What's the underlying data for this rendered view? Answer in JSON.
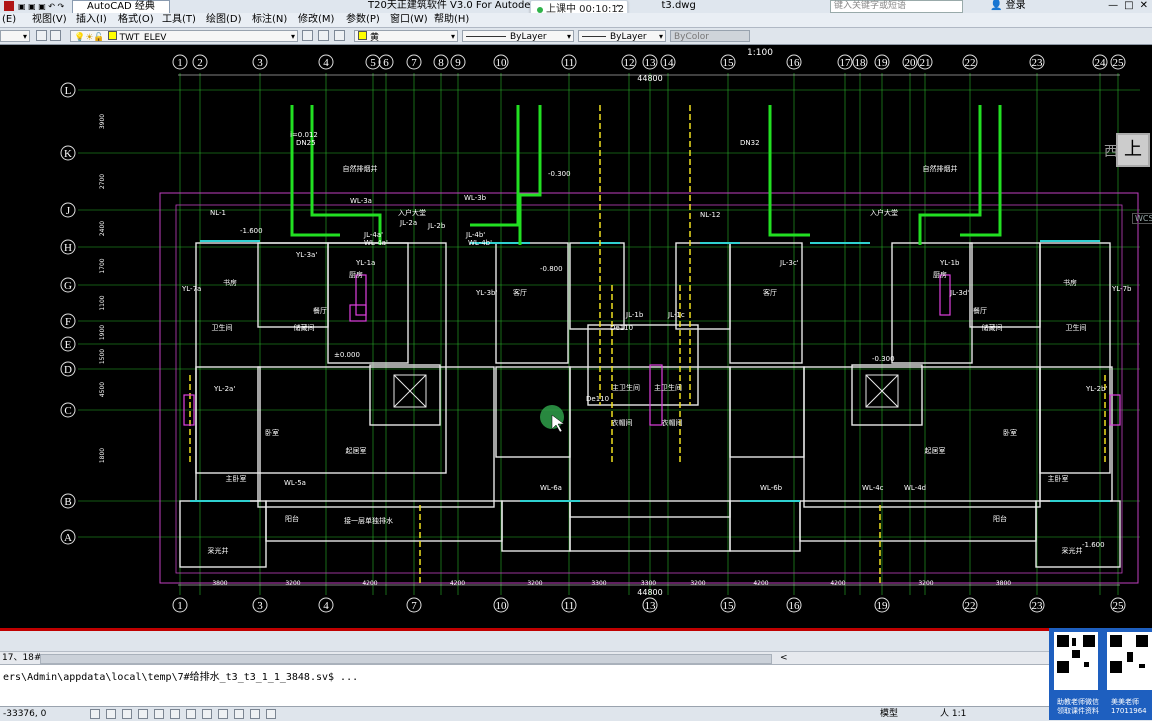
{
  "window": {
    "workspace": "AutoCAD 经典",
    "title": "T20天正建筑软件 V3.0 For Autodesk A",
    "title_tail": "t3.dwg",
    "search_placeholder": "键入关键字或短语",
    "login": "登录",
    "controls": [
      "—",
      "□",
      "✕"
    ]
  },
  "meeting": {
    "status": "上课中 00:10:12"
  },
  "menu": [
    "(E)",
    "视图(V)",
    "插入(I)",
    "格式(O)",
    "工具(T)",
    "绘图(D)",
    "标注(N)",
    "修改(M)",
    "参数(P)",
    "窗口(W)",
    "帮助(H)"
  ],
  "toolbar": {
    "layer": "TWT_ELEV",
    "color": "黄",
    "linetype": "ByLayer",
    "lineweight": "ByLayer",
    "plotstyle": "ByColor"
  },
  "drawing": {
    "axis_numbers": [
      "1",
      "2",
      "3",
      "4",
      "5",
      "6",
      "7",
      "8",
      "9",
      "10",
      "11",
      "12",
      "13",
      "14",
      "15",
      "16",
      "17",
      "18",
      "19",
      "20",
      "21",
      "22",
      "23",
      "24",
      "25"
    ],
    "axis_numbers_bottom": [
      "1",
      "3",
      "4",
      "7",
      "10",
      "11",
      "13",
      "15",
      "16",
      "19",
      "22",
      "23",
      "25"
    ],
    "axis_letters": [
      "L",
      "K",
      "J",
      "H",
      "G",
      "F",
      "E",
      "D",
      "C",
      "B",
      "A"
    ],
    "overall_dim": "44800",
    "scale_label": "1:100",
    "bottom_dims": [
      "3800",
      "3200",
      "4200",
      "4200",
      "3200",
      "3300",
      "3300",
      "3200",
      "4200",
      "4200",
      "3200",
      "3800"
    ],
    "left_dims": [
      "3900",
      "2700",
      "2400",
      "1700",
      "1100",
      "1900",
      "1500",
      "4500",
      "1800"
    ],
    "rooms": [
      {
        "label": "书房"
      },
      {
        "label": "卧室"
      },
      {
        "label": "起居室"
      },
      {
        "label": "主卧室"
      },
      {
        "label": "厨房"
      },
      {
        "label": "餐厅"
      },
      {
        "label": "阳台"
      },
      {
        "label": "储藏间"
      },
      {
        "label": "卫生间"
      },
      {
        "label": "入户大堂"
      },
      {
        "label": "主卫生间"
      },
      {
        "label": "客厅"
      },
      {
        "label": "采光井"
      },
      {
        "label": "衣帽间"
      },
      {
        "label": "自然排烟井"
      }
    ],
    "pipe_labels": [
      "WL-3a",
      "WL-3b",
      "JL-2a",
      "JL-2b",
      "JL-4a'",
      "JL-4b'",
      "YL-3a'",
      "YL-3b'",
      "WL-4a'",
      "WL-4b'",
      "YL-7a",
      "YL-7b",
      "YL-2a'",
      "YL-2b'",
      "WL-5a",
      "WL-6a",
      "WL-6b",
      "WL-4c",
      "WL-4d",
      "YL-1a",
      "YL-1b",
      "NL-1",
      "NL-12",
      "JL-1b",
      "JL-1c",
      "JL-3c'",
      "JL-3d'"
    ],
    "levels": [
      "-1.600",
      "-0.800",
      "-0.300",
      "±0.000",
      "-0.300",
      "-1.600"
    ],
    "notes": [
      "接一层单独排水",
      "De110",
      "De110",
      "DN25",
      "DN32",
      "i=0.012"
    ]
  },
  "cmd": {
    "history": "17、18#",
    "line": "ers\\Admin\\appdata\\local\\temp\\7#给排水_t3_t3_1_1_3848.sv$ ..."
  },
  "status": {
    "coords": "-33376, 0",
    "model": "模型",
    "scale": "人 1:1"
  },
  "promo": {
    "left": "助教老师微信\n领取课件资料",
    "right": "美美老师\n17011964"
  },
  "viewcube": {
    "label": "上",
    "west": "西",
    "wcs": "WCS"
  }
}
